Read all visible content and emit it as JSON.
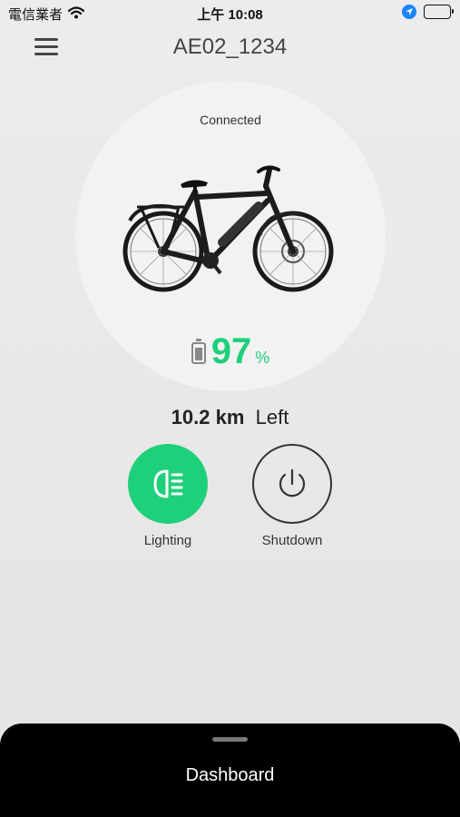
{
  "status_bar": {
    "carrier": "電信業者",
    "time": "上午 10:08"
  },
  "header": {
    "title": "AE02_1234"
  },
  "bike_panel": {
    "connection_status": "Connected",
    "battery_percent": "97",
    "battery_unit": "%"
  },
  "range": {
    "value": "10.2 km",
    "suffix": "Left"
  },
  "controls": {
    "lighting_label": "Lighting",
    "shutdown_label": "Shutdown"
  },
  "bottom_sheet": {
    "label": "Dashboard"
  },
  "colors": {
    "accent_green": "#1fd07a",
    "sheet_bg": "#000000",
    "background": "#e8e8e8"
  }
}
